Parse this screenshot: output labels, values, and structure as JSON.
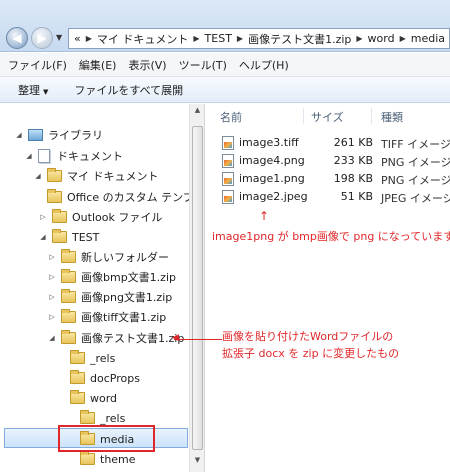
{
  "address": {
    "crumbs": [
      "«",
      "マイ ドキュメント",
      "TEST",
      "画像テスト文書1.zip",
      "word",
      "media"
    ]
  },
  "menu": {
    "items": [
      "ファイル(F)",
      "編集(E)",
      "表示(V)",
      "ツール(T)",
      "ヘルプ(H)"
    ]
  },
  "toolbar": {
    "organize": "整理",
    "burn": "ファイルをすべて展開"
  },
  "tree": {
    "items": [
      {
        "label": "ライブラリ"
      },
      {
        "label": "ドキュメント"
      },
      {
        "label": "マイ ドキュメント"
      },
      {
        "label": "Office のカスタム テンプレ"
      },
      {
        "label": "Outlook ファイル"
      },
      {
        "label": "TEST"
      },
      {
        "label": "新しいフォルダー"
      },
      {
        "label": "画像bmp文書1.zip"
      },
      {
        "label": "画像png文書1.zip"
      },
      {
        "label": "画像tiff文書1.zip"
      },
      {
        "label": "画像テスト文書1.zip"
      },
      {
        "label": "_rels"
      },
      {
        "label": "docProps"
      },
      {
        "label": "word"
      },
      {
        "label": "_rels"
      },
      {
        "label": "media"
      },
      {
        "label": "theme"
      }
    ]
  },
  "columns": {
    "name": "名前",
    "size": "サイズ",
    "type": "種類"
  },
  "files": [
    {
      "name": "image3.tiff",
      "size": "261 KB",
      "type": "TIFF イメージ"
    },
    {
      "name": "image4.png",
      "size": "233 KB",
      "type": "PNG イメージ"
    },
    {
      "name": "image1.png",
      "size": "198 KB",
      "type": "PNG イメージ"
    },
    {
      "name": "image2.jpeg",
      "size": "51 KB",
      "type": "JPEG イメージ"
    }
  ],
  "annotations": {
    "arrow": "↑",
    "note1": "image1png が bmp画像で png になっています",
    "note2_line1": "画像を貼り付けたWordファイルの",
    "note2_line2": "拡張子 docx を zip に変更したもの"
  },
  "colors": {
    "annotation": "#e0262a",
    "selection": "#cce3fa"
  }
}
